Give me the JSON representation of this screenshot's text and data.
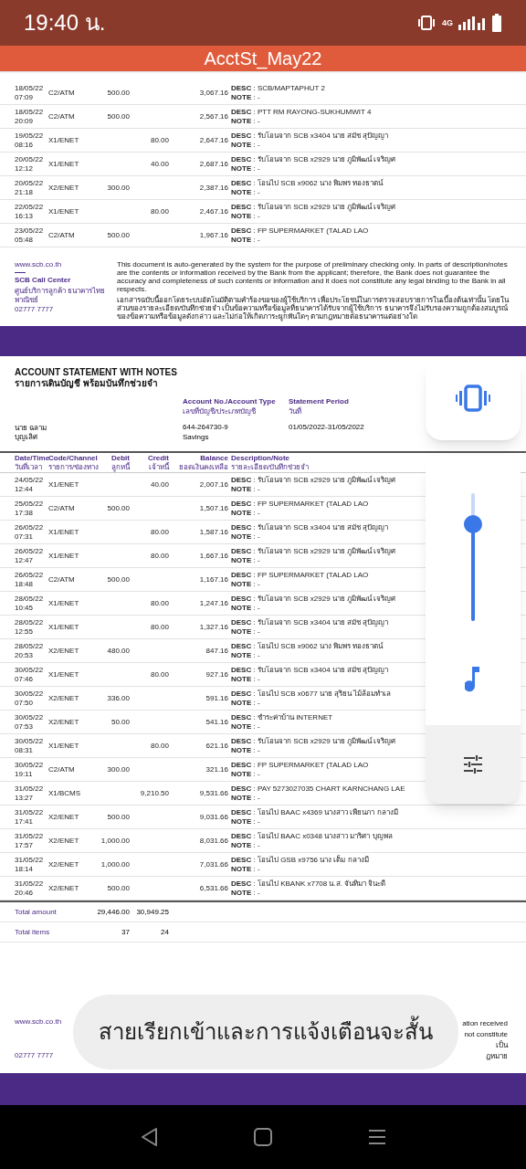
{
  "status_bar": {
    "time": "19:40 น.",
    "network": "4G"
  },
  "title": "AcctSt_May22",
  "page1": {
    "rows": [
      {
        "date": "18/05/22",
        "time": "07:09",
        "code": "C2/ATM",
        "debit": "500.00",
        "balance": "3,067.16",
        "desc": "**DESC** : SCB/MAPTAPHUT 2",
        "note": "**NOTE** : -"
      },
      {
        "date": "18/05/22",
        "time": "20:09",
        "code": "C2/ATM",
        "debit": "500.00",
        "balance": "2,567.16",
        "desc": "**DESC** : PTT RM RAYONG-SUKHUMWIT 4",
        "note": "**NOTE** : -"
      },
      {
        "date": "19/05/22",
        "time": "08:16",
        "code": "X1/ENET",
        "credit": "80.00",
        "balance": "2,647.16",
        "desc": "**DESC** : รับโอนจาก SCB x3404 นาย สมัช สุปัญญา",
        "note": "**NOTE** : -"
      },
      {
        "date": "20/05/22",
        "time": "12:12",
        "code": "X1/ENET",
        "credit": "40.00",
        "balance": "2,687.16",
        "desc": "**DESC** : รับโอนจาก SCB x2929 นาย ภูมิพัฒน์ เจริญศ",
        "note": "**NOTE** : -"
      },
      {
        "date": "20/05/22",
        "time": "21:18",
        "code": "X2/ENET",
        "debit": "300.00",
        "balance": "2,387.16",
        "desc": "**DESC** : โอนไป SCB x9062 นาง พิมพร ทองธาตน์",
        "note": "**NOTE** : -"
      },
      {
        "date": "22/05/22",
        "time": "16:13",
        "code": "X1/ENET",
        "credit": "80.00",
        "balance": "2,467.16",
        "desc": "**DESC** : รับโอนจาก SCB x2929 นาย ภูมิพัฒน์ เจริญศ",
        "note": "**NOTE** : -"
      },
      {
        "date": "23/05/22",
        "time": "05:48",
        "code": "C2/ATM",
        "debit": "500.00",
        "balance": "1,967.16",
        "desc": "**DESC** : FP SUPERMARKET (TALAD LAO",
        "note": "**NOTE** : -"
      }
    ]
  },
  "footers": [
    {
      "website": "www.scb.co.th",
      "call_center": "SCB Call Center",
      "call_center_th": "ศูนย์บริการลูกค้า ธนาคารไทยพาณิชย์",
      "phone": "02777 7777",
      "disclaimer_en": "This document is auto-generated by the system for the purpose of preliminary checking only. In parts of description/notes are the contents or information received by the Bank from the applicant; therefore, the Bank does not guarantee the accuracy and completeness of such contents or information and it does not constitute any legal binding to the Bank in all respects.",
      "disclaimer_th": "เอกสารฉบับนี้ออกโดยระบบอัตโนมัติตามคำร้องขอของผู้ใช้บริการ เพื่อประโยชน์ในการตรวจสอบรายการในเบื้องต้นเท่านั้น โดยในส่วนของรายละเอียด/บันทึกช่วยจำ เป็นข้อความหรือข้อมูลที่ธนาคารได้รับจากผู้ใช้บริการ ธนาคารจึงไม่รับรองความถูกต้องสมบูรณ์ของข้อความหรือข้อมูลดังกล่าว และไม่ก่อให้เกิดภาระผูกพันใดๆ ตามกฎหมายต่อธนาคารแต่อย่างใด"
    },
    {
      "website": "www.scb.co.th",
      "phone": "02777 7777",
      "fragments": [
        "ation received",
        "not constitute",
        "เป็น",
        "ฎหมาย"
      ]
    }
  ],
  "page2": {
    "heading": "ACCOUNT STATEMENT WITH NOTES",
    "heading_th": "รายการเดินบัญชี พร้อมบันทึกช่วยจำ",
    "account_label": "Account No./Account Type",
    "account_label_th": "เลขที่บัญชี/ประเภทบัญชี",
    "period_label": "Statement Period",
    "period_label_th": "วันที่",
    "customer_name": [
      "นาย ฉลาม",
      "บุญเลิศ"
    ],
    "account_no": "644-264730-9",
    "account_type": "Savings",
    "period": "01/05/2022-31/05/2022",
    "columns": [
      {
        "en": "Date/Time",
        "th": "วันที่เวลา"
      },
      {
        "en": "Code/Channel",
        "th": "รายการ/ช่องทาง"
      },
      {
        "en": "Debit",
        "th": "ลูกหนี้"
      },
      {
        "en": "Credit",
        "th": "เจ้าหนี้"
      },
      {
        "en": "Balance",
        "th": "ยอดเงินคงเหลือ"
      },
      {
        "en": "Description/Note",
        "th": "รายละเอียด/บันทึกช่วยจำ"
      }
    ],
    "rows": [
      {
        "date": "24/05/22",
        "time": "12:44",
        "code": "X1/ENET",
        "credit": "40.00",
        "balance": "2,007.16",
        "desc": "**DESC** : รับโอนจาก SCB x2929 นาย ภูมิพัฒน์ เจริญศ",
        "note": "**NOTE** : -"
      },
      {
        "date": "25/05/22",
        "time": "17:38",
        "code": "C2/ATM",
        "debit": "500.00",
        "balance": "1,507.16",
        "desc": "**DESC** : FP SUPERMARKET (TALAD LAO",
        "note": "**NOTE** : -"
      },
      {
        "date": "26/05/22",
        "time": "07:31",
        "code": "X1/ENET",
        "credit": "80.00",
        "balance": "1,587.16",
        "desc": "**DESC** : รับโอนจาก SCB x3404 นาย สมัช สุปัญญา",
        "note": "**NOTE** : -"
      },
      {
        "date": "26/05/22",
        "time": "12:47",
        "code": "X1/ENET",
        "credit": "80.00",
        "balance": "1,667.16",
        "desc": "**DESC** : รับโอนจาก SCB x2929 นาย ภูมิพัฒน์ เจริญศ",
        "note": "**NOTE** : -"
      },
      {
        "date": "26/05/22",
        "time": "18:48",
        "code": "C2/ATM",
        "debit": "500.00",
        "balance": "1,167.16",
        "desc": "**DESC** : FP SUPERMARKET (TALAD LAO",
        "note": "**NOTE** : -"
      },
      {
        "date": "28/05/22",
        "time": "10:45",
        "code": "X1/ENET",
        "credit": "80.00",
        "balance": "1,247.16",
        "desc": "**DESC** : รับโอนจาก SCB x2929 นาย ภูมิพัฒน์ เจริญศ",
        "note": "**NOTE** : -"
      },
      {
        "date": "28/05/22",
        "time": "12:55",
        "code": "X1/ENET",
        "credit": "80.00",
        "balance": "1,327.16",
        "desc": "**DESC** : รับโอนจาก SCB x3404 นาย สมัช สุปัญญา",
        "note": "**NOTE** : -"
      },
      {
        "date": "28/05/22",
        "time": "20:53",
        "code": "X2/ENET",
        "debit": "480.00",
        "balance": "847.16",
        "desc": "**DESC** : โอนไป SCB x9062 นาง พิมพร ทองธาตน์",
        "note": "**NOTE** : -"
      },
      {
        "date": "30/05/22",
        "time": "07:46",
        "code": "X1/ENET",
        "credit": "80.00",
        "balance": "927.16",
        "desc": "**DESC** : รับโอนจาก SCB x3404 นาย สมัช สุปัญญา",
        "note": "**NOTE** : -"
      },
      {
        "date": "30/05/22",
        "time": "07:50",
        "code": "X2/ENET",
        "debit": "336.00",
        "balance": "591.16",
        "desc": "**DESC** : โอนไป SCB x0677 นาย สุริยน ไม้ล้อมทำเล",
        "note": "**NOTE** : -"
      },
      {
        "date": "30/05/22",
        "time": "07:53",
        "code": "X2/ENET",
        "debit": "50.00",
        "balance": "541.16",
        "desc": "**DESC** : ชำระค่าบ้าน INTERNET",
        "note": "**NOTE** : -"
      },
      {
        "date": "30/05/22",
        "time": "08:31",
        "code": "X1/ENET",
        "credit": "80.00",
        "balance": "621.16",
        "desc": "**DESC** : รับโอนจาก SCB x2929 นาย ภูมิพัฒน์ เจริญศ",
        "note": "**NOTE** : -"
      },
      {
        "date": "30/05/22",
        "time": "19:11",
        "code": "C2/ATM",
        "debit": "300.00",
        "balance": "321.16",
        "desc": "**DESC** : FP SUPERMARKET (TALAD LAO",
        "note": "**NOTE** : -"
      },
      {
        "date": "31/05/22",
        "time": "13:27",
        "code": "X1/BCMS",
        "credit": "9,210.50",
        "balance": "9,531.66",
        "desc": "**DESC** :  PAY 5273027035 CHART KARNCHANG LAE",
        "note": "**NOTE** : -"
      },
      {
        "date": "31/05/22",
        "time": "17:41",
        "code": "X2/ENET",
        "debit": "500.00",
        "balance": "9,031.66",
        "desc": "**DESC** : โอนไป BAAC x4369 นางสาว เพียนภา กลางมี",
        "note": "**NOTE** : -"
      },
      {
        "date": "31/05/22",
        "time": "17:57",
        "code": "X2/ENET",
        "debit": "1,000.00",
        "balance": "8,031.66",
        "desc": "**DESC** : โอนไป BAAC x0348 นางสาว มาริศา บุญพล",
        "note": "**NOTE** : -"
      },
      {
        "date": "31/05/22",
        "time": "18:14",
        "code": "X2/ENET",
        "debit": "1,000.00",
        "balance": "7,031.66",
        "desc": "**DESC** : โอนไป GSB x9756 นาง เต็ม กลางมี",
        "note": "**NOTE** : -"
      },
      {
        "date": "31/05/22",
        "time": "20:46",
        "code": "X2/ENET",
        "debit": "500.00",
        "balance": "6,531.66",
        "desc": "**DESC** : โอนไป KBANK x7708 น.ส. จันทิมา จินะดี",
        "note": "**NOTE** : -"
      }
    ],
    "totals": [
      {
        "label": "Total amount",
        "debit": "29,446.00",
        "credit": "30,949.25"
      },
      {
        "label": "Total items",
        "debit": "37",
        "credit": "24"
      }
    ]
  },
  "volume_panel": {
    "level": 0.76
  },
  "toast": "สายเรียกเข้าและการแจ้งเตือนจะสั้น"
}
